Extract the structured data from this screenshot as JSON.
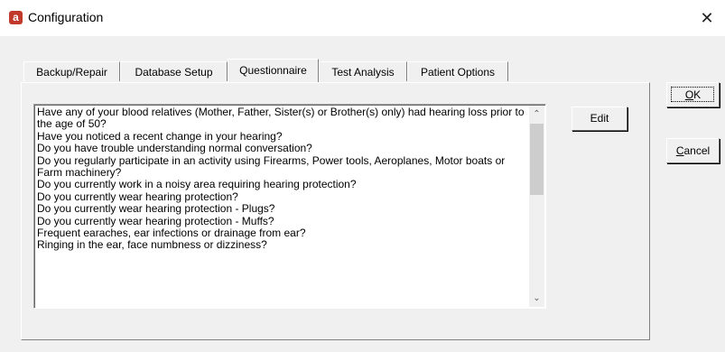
{
  "window": {
    "title": "Configuration",
    "icon_glyph": "a",
    "close_glyph": "✕"
  },
  "tabs": [
    {
      "label": "Backup/Repair"
    },
    {
      "label": "Database Setup"
    },
    {
      "label": "Questionnaire",
      "active": true
    },
    {
      "label": "Test Analysis"
    },
    {
      "label": "Patient Options"
    }
  ],
  "questions": [
    "Have any of your blood relatives (Mother, Father, Sister(s) or Brother(s) only) had hearing loss prior to the age of 50?",
    "Have you noticed a recent change in your hearing?",
    "Do you have trouble understanding normal conversation?",
    "Do you regularly participate in an activity using Firearms, Power tools, Aeroplanes, Motor boats or Farm machinery?",
    "Do you currently work in a noisy area requiring hearing protection?",
    "Do you currently wear hearing protection?",
    "Do you currently wear hearing protection - Plugs?",
    "Do you currently wear hearing protection - Muffs?",
    "Frequent earaches, ear infections or drainage from ear?",
    "Ringing in the ear, face numbness or dizziness?"
  ],
  "scroll": {
    "up_glyph": "⌃",
    "down_glyph": "⌄"
  },
  "buttons": {
    "edit": "Edit",
    "ok_mnemonic": "O",
    "ok_rest": "K",
    "cancel_mnemonic": "C",
    "cancel_rest": "ancel"
  }
}
